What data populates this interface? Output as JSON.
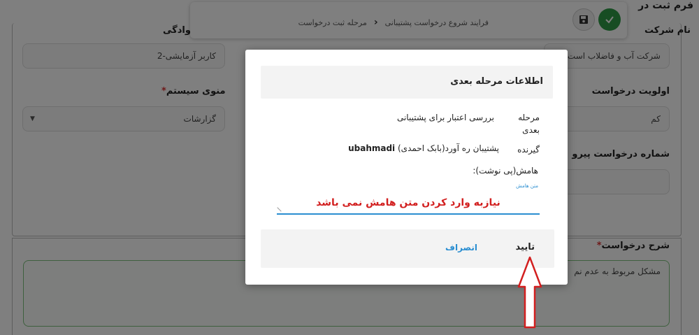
{
  "form": {
    "title": "فرم ثبت در",
    "company_label": "نام شرکت",
    "company_value": "شرکت آب و فاضلاب است",
    "family_label": "خانوادگی",
    "family_value": "کاربر آزمایشی-2",
    "priority_label": "اولویت درخواست",
    "priority_value": "کم",
    "system_menu_label": "منوی سیستم",
    "system_menu_value": "گزارشات",
    "followup_label": "شماره درخواست پیرو",
    "description_label": "شرح درخواست",
    "description_value": "مشکل مربوط  به عدم نم"
  },
  "toolbar": {
    "breadcrumb": [
      "فرایند شروع درخواست پشتیبانی",
      "مرحله ثبت درخواست"
    ]
  },
  "modal": {
    "title": "اطلاعات مرحله بعدی",
    "next_step_label": "مرحله بعدی",
    "next_step_value": "بررسی اعتبار برای پشتیبانی",
    "receiver_label": "گیرنده",
    "receiver_name": "پشتیبان ره آورد(بابک احمدی)",
    "receiver_user": "ubahmadi",
    "note_label": "هامش(پی نوشت):",
    "note_caption": "متن هامش",
    "note_annotation": "نیازبه وارد کردن متن هامش نمی باشد",
    "confirm_label": "تایید",
    "cancel_label": "انصراف"
  },
  "colors": {
    "accent": "#2a8ed1",
    "success": "#2e9a46",
    "annotation": "#d21f1f"
  }
}
